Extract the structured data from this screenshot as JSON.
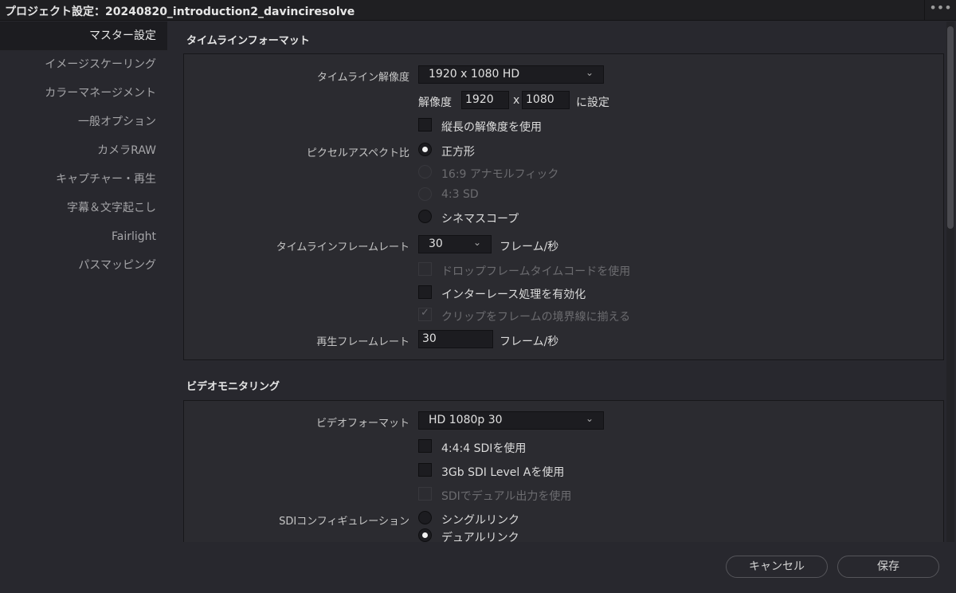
{
  "window": {
    "title": "プロジェクト設定：20240820_introduction2_davinciresolve",
    "more_label": "•••"
  },
  "sidebar": {
    "items": [
      {
        "label": "マスター設定",
        "active": true
      },
      {
        "label": "イメージスケーリング"
      },
      {
        "label": "カラーマネージメント"
      },
      {
        "label": "一般オプション"
      },
      {
        "label": "カメラRAW"
      },
      {
        "label": "キャプチャー・再生"
      },
      {
        "label": "字幕＆文字起こし"
      },
      {
        "label": "Fairlight"
      },
      {
        "label": "パスマッピング"
      }
    ]
  },
  "timeline_format": {
    "section_title": "タイムラインフォーマット",
    "resolution_label": "タイムライン解像度",
    "resolution_value": "1920 x 1080 HD",
    "custom_prefix": "解像度",
    "width_value": "1920",
    "x_sep": "x",
    "height_value": "1080",
    "custom_suffix": "に設定",
    "vertical_label": "縦長の解像度を使用",
    "pixel_aspect_label": "ピクセルアスペクト比",
    "aspect_options": [
      "正方形",
      "16:9 アナモルフィック",
      "4:3 SD",
      "シネマスコープ"
    ],
    "aspect_selected": "正方形",
    "frame_rate_label": "タイムラインフレームレート",
    "frame_rate_value": "30",
    "frame_rate_unit": "フレーム/秒",
    "drop_frame_label": "ドロップフレームタイムコードを使用",
    "interlace_label": "インターレース処理を有効化",
    "clip_border_label": "クリップをフレームの境界線に揃える",
    "clip_border_checked": true,
    "playback_rate_label": "再生フレームレート",
    "playback_rate_value": "30",
    "playback_rate_unit": "フレーム/秒"
  },
  "video_monitoring": {
    "section_title": "ビデオモニタリング",
    "video_format_label": "ビデオフォーマット",
    "video_format_value": "HD 1080p 30",
    "sdi_444_label": "4:4:4 SDIを使用",
    "sdi_3gb_label": "3Gb SDI Level Aを使用",
    "sdi_dual_label": "SDIでデュアル出力を使用",
    "sdi_config_label": "SDIコンフィギュレーション",
    "sdi_options": [
      "シングルリンク",
      "デュアルリンク"
    ],
    "sdi_selected": "デュアルリンク"
  },
  "footer": {
    "cancel_label": "キャンセル",
    "save_label": "保存"
  },
  "colors": {
    "background": "#28282e",
    "panel": "#2b2b30",
    "field": "#1c1c20",
    "text": "#d9d9d9",
    "disabled_text": "#6c6c70"
  }
}
